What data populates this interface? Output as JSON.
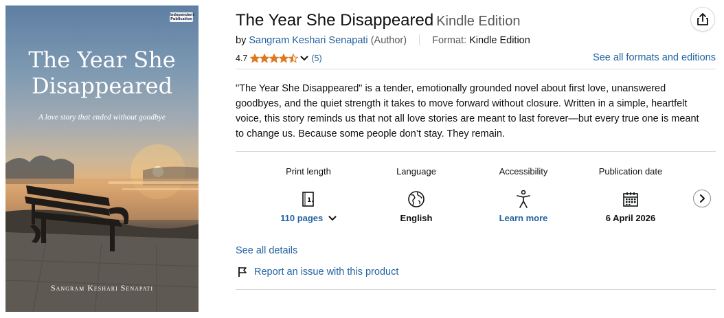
{
  "cover": {
    "publisher_badge": "Independent Publication",
    "title_line1": "The Year She",
    "title_line2": "Disappeared",
    "tagline": "A love story that ended without goodbye",
    "author": "Sangram Keshari Senapati"
  },
  "product": {
    "title": "The Year She Disappeared",
    "edition": "Kindle Edition",
    "by": "by",
    "author": "Sangram Keshari Senapati",
    "author_role": "(Author)",
    "format_label": "Format:",
    "format_value": "Kindle Edition",
    "rating": {
      "score": "4.7",
      "stars_filled": 4.5,
      "count": "(5)"
    },
    "formats_link": "See all formats and editions",
    "description": "\"The Year She Disappeared\" is a tender, emotionally grounded novel about first love, unanswered goodbyes, and the quiet strength it takes to move forward without closure. Written in a simple, heartfelt voice, this story reminds us that not all love stories are meant to last forever—but every true one is meant to change us. Because some people don’t stay. They remain."
  },
  "details": [
    {
      "label": "Print length",
      "icon": "book-pages-icon",
      "value": "110 pages"
    },
    {
      "label": "Language",
      "icon": "globe-icon",
      "value": "English"
    },
    {
      "label": "Accessibility",
      "icon": "accessibility-person-icon",
      "value": "Learn more"
    },
    {
      "label": "Publication date",
      "icon": "calendar-icon",
      "value": "6 April 2026"
    }
  ],
  "links": {
    "see_all_details": "See all details",
    "report_issue": "Report an issue with this product"
  },
  "colors": {
    "link": "#2162a1",
    "star": "#de7921",
    "text": "#0f1111",
    "muted": "#565959",
    "divider": "#d5d9d9"
  }
}
